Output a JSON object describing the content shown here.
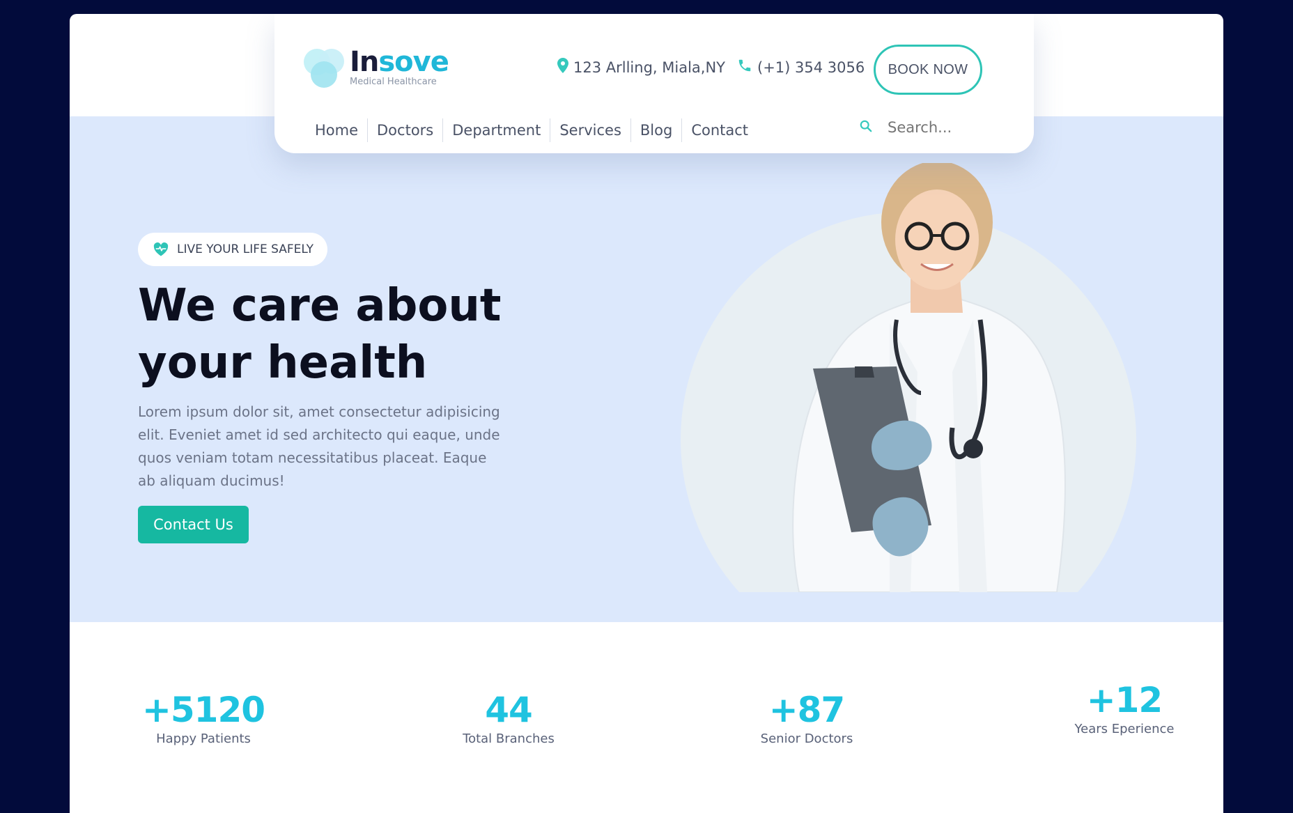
{
  "brand": {
    "name_part1": "In",
    "name_part2": "sove",
    "tagline": "Medical Healthcare"
  },
  "header": {
    "address": "123 Arlling, Miala,NY",
    "phone": "(+1) 354 3056",
    "book_label": "BOOK NOW"
  },
  "nav": {
    "items": [
      {
        "label": "Home"
      },
      {
        "label": "Doctors"
      },
      {
        "label": "Department"
      },
      {
        "label": "Services"
      },
      {
        "label": "Blog"
      },
      {
        "label": "Contact"
      }
    ],
    "search_placeholder": "Search..."
  },
  "hero": {
    "badge": "LIVE YOUR LIFE SAFELY",
    "title_line1": "We care about",
    "title_line2": "your health",
    "description": "Lorem ipsum dolor sit, amet consectetur adipisicing elit. Eveniet amet id sed architecto qui eaque, unde quos veniam totam necessitatibus placeat. Eaque ab aliquam ducimus!",
    "cta_label": "Contact Us"
  },
  "stats": [
    {
      "value": "+5120",
      "label": "Happy Patients"
    },
    {
      "value": "44",
      "label": "Total Branches"
    },
    {
      "value": "+87",
      "label": "Senior Doctors"
    },
    {
      "value": "+12",
      "label": "Years Eperience"
    }
  ],
  "colors": {
    "accent_teal": "#16b8a1",
    "stat_cyan": "#1fc3e0",
    "hero_bg": "#dce8fc",
    "page_bg": "#020b3b"
  },
  "icons": {
    "address": "location-pin-icon",
    "phone": "phone-icon",
    "search": "search-icon",
    "badge": "heart-pulse-icon"
  }
}
